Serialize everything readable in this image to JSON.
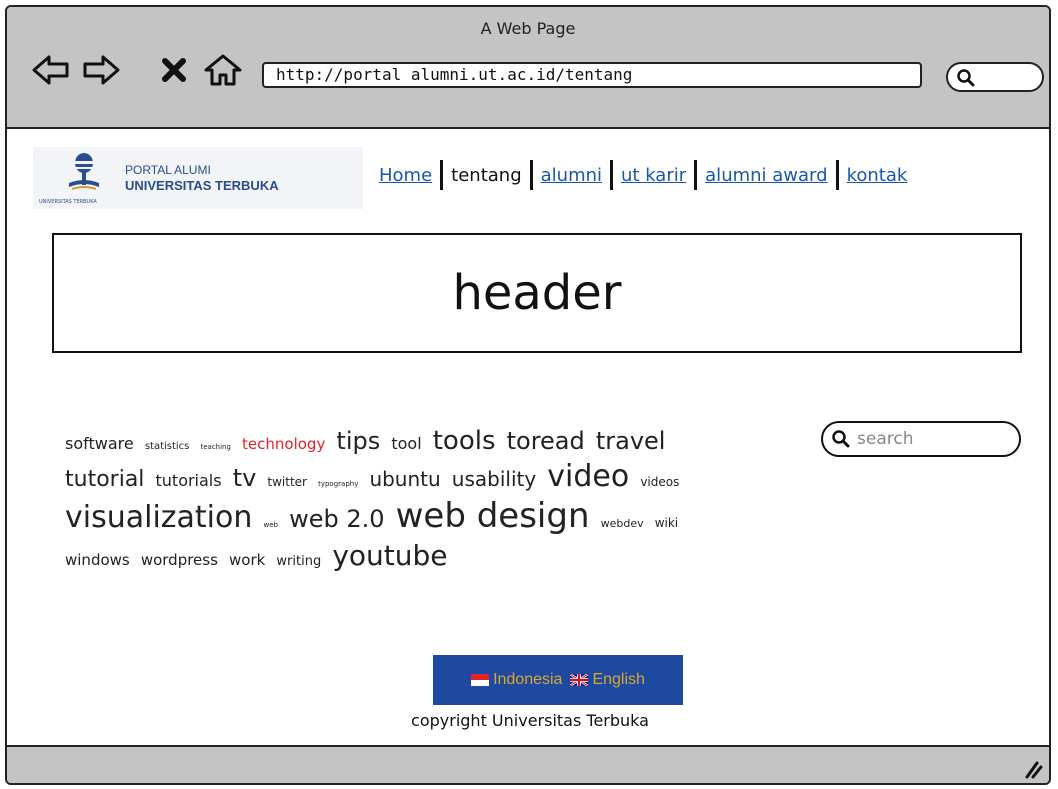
{
  "window": {
    "title": "A Web Page"
  },
  "toolbar": {
    "url": "http://portal alumni.ut.ac.id/tentang",
    "icons": [
      "back-icon",
      "forward-icon",
      "close-icon",
      "home-icon",
      "search-icon"
    ]
  },
  "logo": {
    "line1": "PORTAL ALUMI",
    "line2": "UNIVERSITAS TERBUKA",
    "mini": "UNIVERSITAS TERBUKA"
  },
  "nav": {
    "items": [
      {
        "label": "Home",
        "current": false
      },
      {
        "label": "tentang",
        "current": true
      },
      {
        "label": "alumni",
        "current": false
      },
      {
        "label": "ut karir",
        "current": false
      },
      {
        "label": "alumni award",
        "current": false
      },
      {
        "label": "kontak",
        "current": false
      }
    ]
  },
  "header": {
    "label": "header"
  },
  "tagcloud": {
    "tags": [
      {
        "text": "software",
        "size": 16,
        "color": "#222222"
      },
      {
        "text": "statistics",
        "size": 10,
        "color": "#222222"
      },
      {
        "text": "teaching",
        "size": 7,
        "color": "#222222"
      },
      {
        "text": "technology",
        "size": 15,
        "color": "#e0242b"
      },
      {
        "text": "tips",
        "size": 24,
        "color": "#222222"
      },
      {
        "text": "tool",
        "size": 16,
        "color": "#222222"
      },
      {
        "text": "tools",
        "size": 26,
        "color": "#222222"
      },
      {
        "text": "toread",
        "size": 24,
        "color": "#222222"
      },
      {
        "text": "travel",
        "size": 24,
        "color": "#222222"
      },
      {
        "text": "tutorial",
        "size": 22,
        "color": "#222222"
      },
      {
        "text": "tutorials",
        "size": 16,
        "color": "#222222"
      },
      {
        "text": "tv",
        "size": 24,
        "color": "#222222"
      },
      {
        "text": "twitter",
        "size": 12,
        "color": "#222222"
      },
      {
        "text": "typography",
        "size": 7,
        "color": "#222222"
      },
      {
        "text": "ubuntu",
        "size": 20,
        "color": "#222222"
      },
      {
        "text": "usability",
        "size": 20,
        "color": "#222222"
      },
      {
        "text": "video",
        "size": 30,
        "color": "#222222"
      },
      {
        "text": "videos",
        "size": 12,
        "color": "#222222"
      },
      {
        "text": "visualization",
        "size": 30,
        "color": "#222222"
      },
      {
        "text": "web",
        "size": 7,
        "color": "#222222"
      },
      {
        "text": "web 2.0",
        "size": 24,
        "color": "#222222"
      },
      {
        "text": "web design",
        "size": 34,
        "color": "#222222"
      },
      {
        "text": "webdev",
        "size": 11,
        "color": "#222222"
      },
      {
        "text": "wiki",
        "size": 12,
        "color": "#222222"
      },
      {
        "text": "windows",
        "size": 15,
        "color": "#222222"
      },
      {
        "text": "wordpress",
        "size": 15,
        "color": "#222222"
      },
      {
        "text": "work",
        "size": 15,
        "color": "#222222"
      },
      {
        "text": "writing",
        "size": 13,
        "color": "#222222"
      },
      {
        "text": "youtube",
        "size": 28,
        "color": "#222222"
      }
    ]
  },
  "search": {
    "placeholder": "search"
  },
  "language": {
    "options": [
      {
        "label": "Indonesia",
        "flag": "indonesia-flag-icon"
      },
      {
        "label": "English",
        "flag": "uk-flag-icon"
      }
    ],
    "background": "#1d4aa0",
    "text_color": "#d9a72c"
  },
  "footer": {
    "copyright": "copyright Universitas Terbuka"
  }
}
